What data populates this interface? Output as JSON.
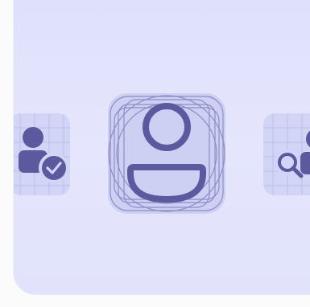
{
  "stage": {
    "background": "#e3e4fc",
    "tile_color": "#d2d5f5",
    "grid_color": "#b7bbea",
    "icon_color": "#5b5a9e"
  },
  "icons": [
    {
      "name": "person-check-icon",
      "selected": false
    },
    {
      "name": "person-outline-icon",
      "selected": true
    },
    {
      "name": "person-search-icon",
      "selected": false
    }
  ]
}
